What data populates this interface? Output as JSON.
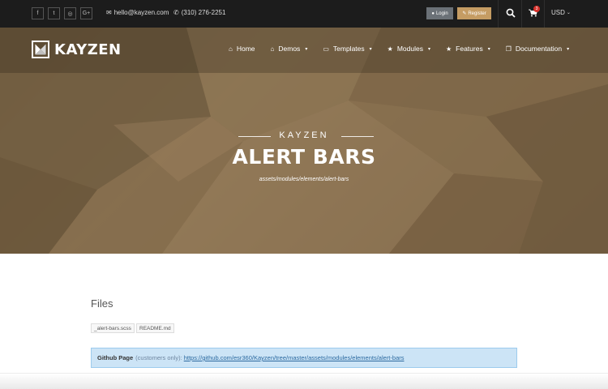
{
  "colors": {
    "topbar": "#1c1c1c",
    "login_button": "#6b7177",
    "register_button": "#c59c63",
    "hero_brown": "#7e6647",
    "alert_info_bg": "#cce4f6",
    "link": "#2c6aa0",
    "cart_badge": "#d9312b"
  },
  "topbar": {
    "social": [
      {
        "icon": "facebook-icon",
        "glyph": "f"
      },
      {
        "icon": "twitter-icon",
        "glyph": "t"
      },
      {
        "icon": "instagram-icon",
        "glyph": "◎"
      },
      {
        "icon": "google-plus-icon",
        "glyph": "G+"
      }
    ],
    "email": "hello@kayzen.com",
    "phone": "(310) 276-2251",
    "login_label": "Login",
    "register_label": "Register",
    "cart_count": "3",
    "currency": "USD"
  },
  "brand": {
    "name": "KAYZEN"
  },
  "nav": {
    "items": [
      {
        "label": "Home",
        "icon": "home-icon",
        "has_dropdown": false
      },
      {
        "label": "Demos",
        "icon": "home-icon",
        "has_dropdown": true
      },
      {
        "label": "Templates",
        "icon": "monitor-icon",
        "has_dropdown": true
      },
      {
        "label": "Modules",
        "icon": "star-icon",
        "has_dropdown": true
      },
      {
        "label": "Features",
        "icon": "star-icon",
        "has_dropdown": true
      },
      {
        "label": "Documentation",
        "icon": "copy-icon",
        "has_dropdown": true
      }
    ]
  },
  "hero": {
    "kicker": "KAYZEN",
    "title": "ALERT BARS",
    "path": "assets/modules/elements/alert-bars"
  },
  "files": {
    "heading": "Files",
    "items": [
      "_alert-bars.scss",
      "README.md"
    ]
  },
  "github": {
    "label": "Github Page",
    "note": "(customers only):",
    "url": "https://github.com/esr360/Kayzen/tree/master/assets/modules/elements/alert-bars"
  }
}
